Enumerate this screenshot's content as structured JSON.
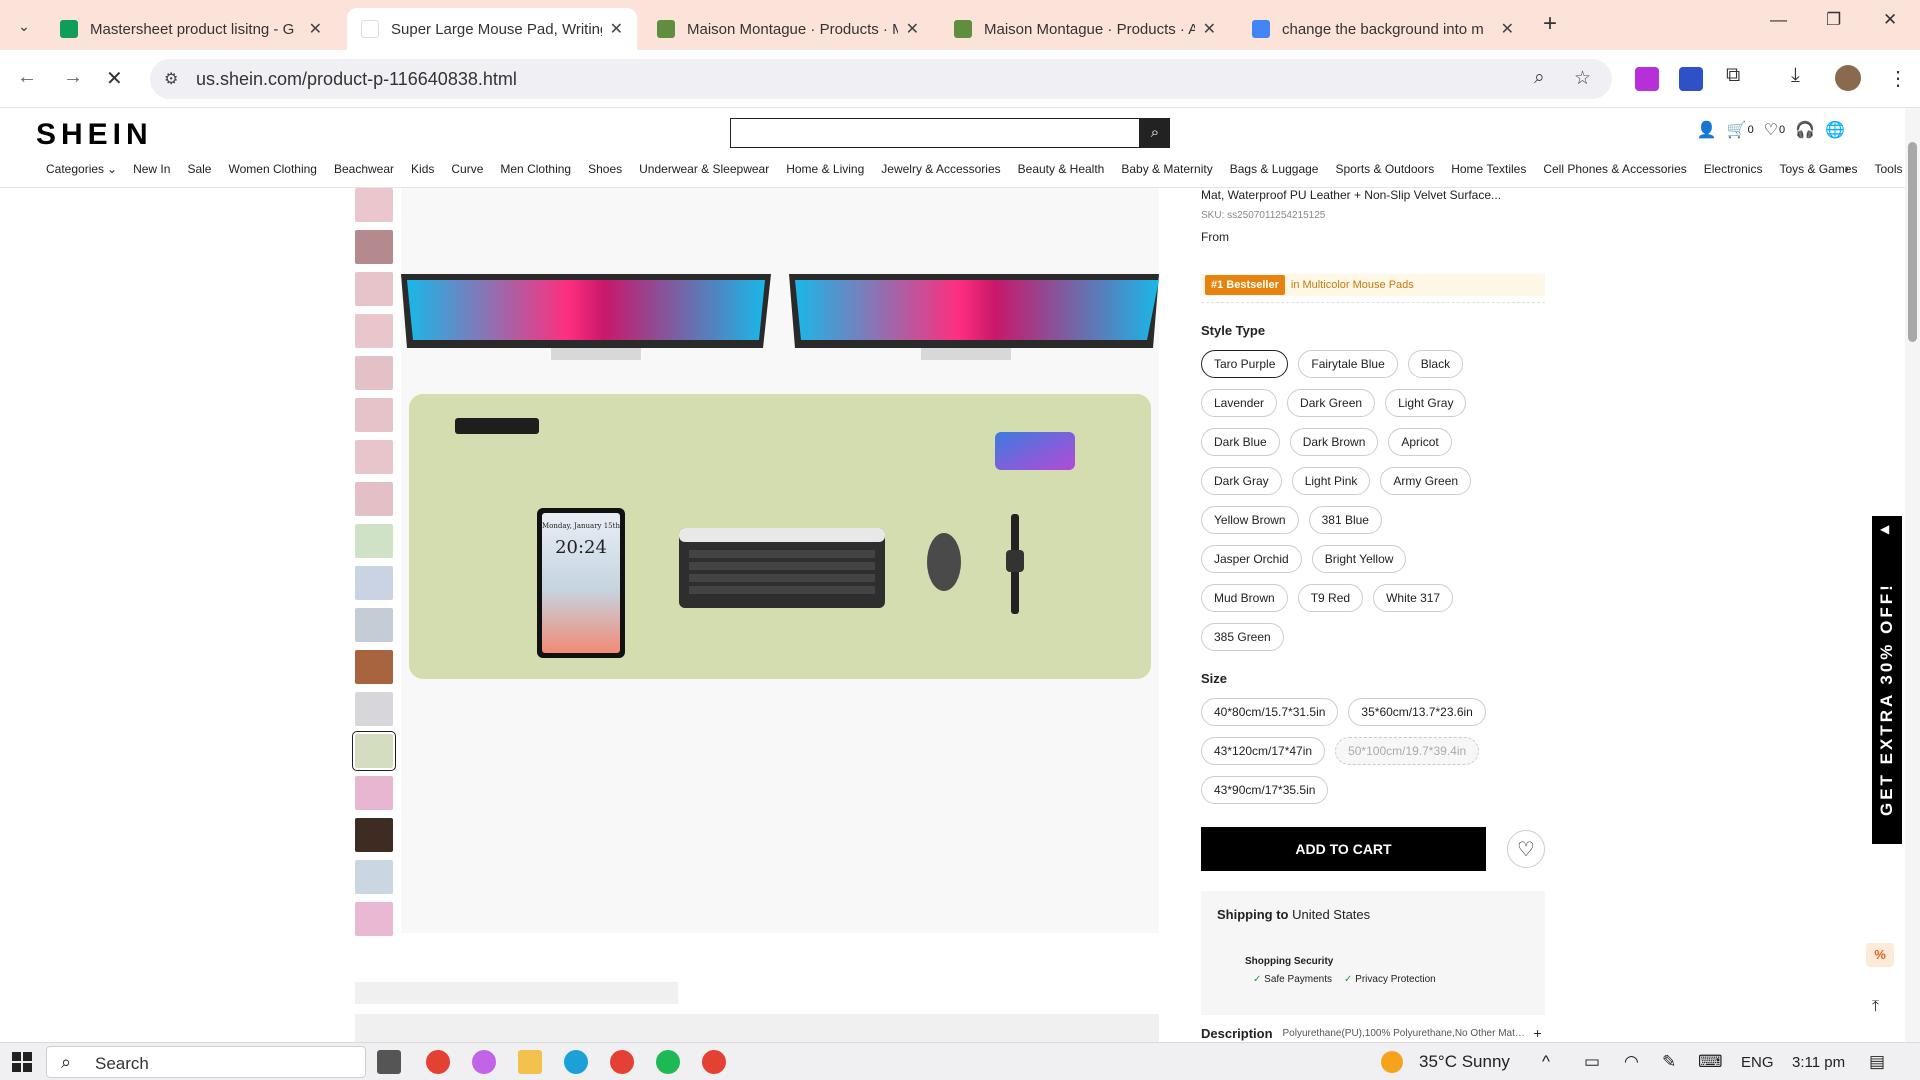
{
  "browser": {
    "tabs": [
      {
        "title": "Mastersheet product lisitng - G",
        "favicon_color": "#0f9d58",
        "active": false
      },
      {
        "title": "Super Large Mouse Pad, Writing",
        "favicon_color": "#ffffff",
        "active": true
      },
      {
        "title": "Maison Montague · Products · M",
        "favicon_color": "#5e8e3e",
        "active": false
      },
      {
        "title": "Maison Montague · Products · A",
        "favicon_color": "#5e8e3e",
        "active": false
      },
      {
        "title": "change the background into m",
        "favicon_color": "#4285f4",
        "active": false
      }
    ],
    "url": "us.shein.com/product-p-116640838.html"
  },
  "site": {
    "logo": "SHEIN",
    "search_placeholder": "",
    "header_counts": {
      "cart": "0",
      "wishlist": "0"
    },
    "categories": [
      "Categories",
      "New In",
      "Sale",
      "Women Clothing",
      "Beachwear",
      "Kids",
      "Curve",
      "Men Clothing",
      "Shoes",
      "Underwear & Sleepwear",
      "Home & Living",
      "Jewelry & Accessories",
      "Beauty & Health",
      "Baby & Maternity",
      "Bags & Luggage",
      "Sports & Outdoors",
      "Home Textiles",
      "Cell Phones & Accessories",
      "Electronics",
      "Toys & Games",
      "Tools & Hor"
    ]
  },
  "product": {
    "title": "Mat, Waterproof PU Leather + Non-Slip Velvet Surface...",
    "sku": "SKU: ss2507011254215125",
    "from": "From",
    "bestseller_rank": "#1 Bestseller",
    "bestseller_category": "in Multicolor Mouse Pads",
    "style_title": "Style Type",
    "styles": [
      "Taro Purple",
      "Fairytale Blue",
      "Black",
      "Lavender",
      "Dark Green",
      "Light Gray",
      "Dark Blue",
      "Dark Brown",
      "Apricot",
      "Dark Gray",
      "Light Pink",
      "Army Green",
      "Yellow Brown",
      "381 Blue",
      "Jasper Orchid",
      "Bright Yellow",
      "Mud Brown",
      "T9 Red",
      "White 317",
      "385 Green"
    ],
    "selected_style": "Taro Purple",
    "size_title": "Size",
    "sizes": [
      "40*80cm/15.7*31.5in",
      "35*60cm/13.7*23.6in",
      "43*120cm/17*47in",
      "50*100cm/19.7*39.4in",
      "43*90cm/17*35.5in"
    ],
    "disabled_size": "50*100cm/19.7*39.4in",
    "add_to_cart": "ADD TO CART",
    "shipping_label": "Shipping to",
    "shipping_country": "United States",
    "security_title": "Shopping Security",
    "security_items": [
      "Safe Payments",
      "Privacy Protection"
    ],
    "description_label": "Description",
    "description_value": "Polyurethane(PU),100% Polyurethane,No Other Mater...",
    "tablet_date": "Monday, January 15th",
    "tablet_time": "20:24",
    "thumbnail_colors": [
      "#e9c7cc",
      "#b58a8f",
      "#e6c4c9",
      "#e8c6cb",
      "#e3c1c6",
      "#e5c3c8",
      "#e7c5ca",
      "#e2c0c5",
      "#cfe2c5",
      "#cad3e4",
      "#c6ccd6",
      "#a7643f",
      "#d6d6db",
      "#d4ddc0",
      "#e7b6d1",
      "#3e2c22",
      "#cbd6e3",
      "#e9b9d3"
    ],
    "selected_thumb_index": 13
  },
  "promo": {
    "text": "GET EXTRA 30% OFF!",
    "badge": "%"
  },
  "taskbar": {
    "search": "Search",
    "weather": "35°C  Sunny",
    "lang": "ENG",
    "time": "3:11 pm"
  }
}
